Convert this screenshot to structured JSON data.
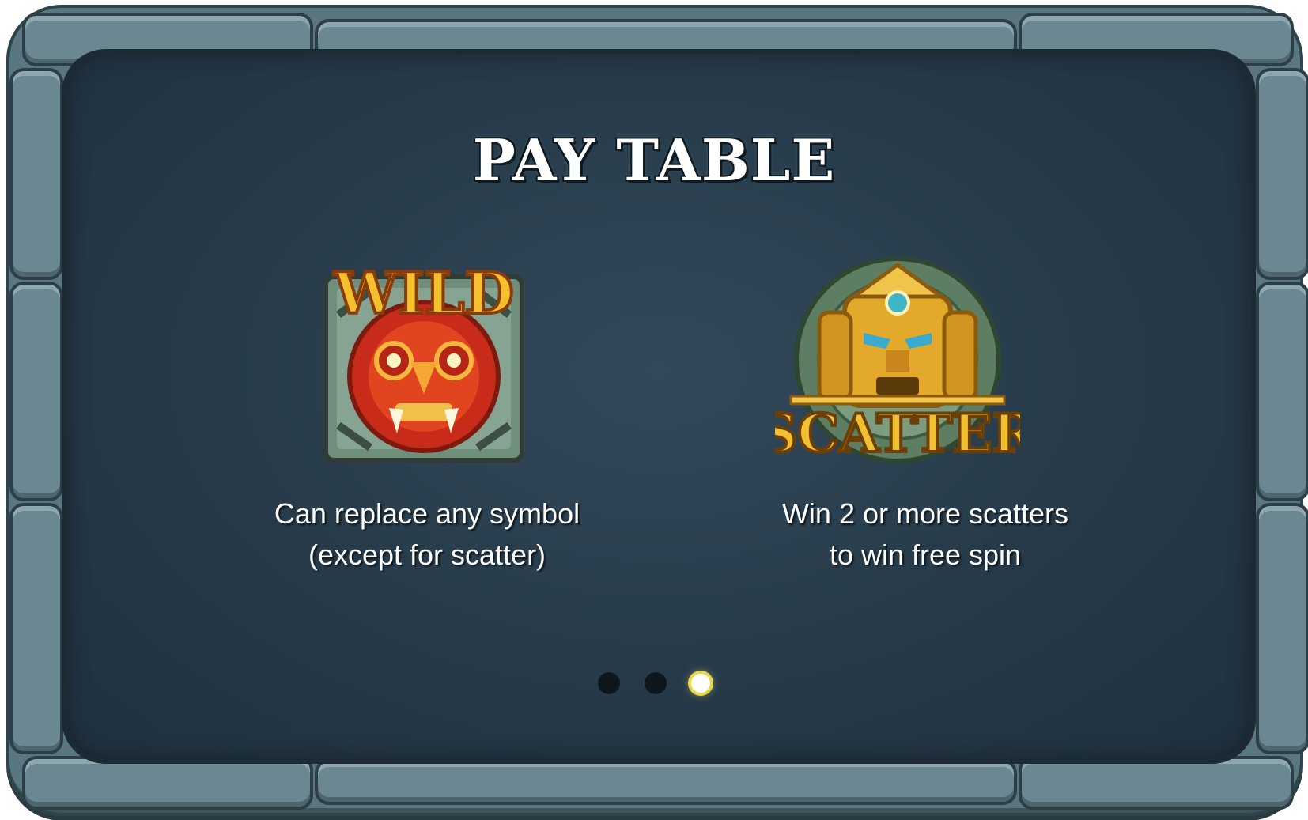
{
  "title": "PAY TABLE",
  "symbols": [
    {
      "name": "WILD",
      "description_line1": "Can replace any symbol",
      "description_line2": "(except for scatter)"
    },
    {
      "name": "SCATTER",
      "description_line1": "Win 2 or more scatters",
      "description_line2": "to win free spin"
    }
  ],
  "pagination": {
    "total": 3,
    "active": 3
  },
  "colors": {
    "panel": "#263a49",
    "frame": "#5a7680",
    "gold": "#f2b52a",
    "red": "#d9341f",
    "dot_active": "#e9d64a"
  }
}
